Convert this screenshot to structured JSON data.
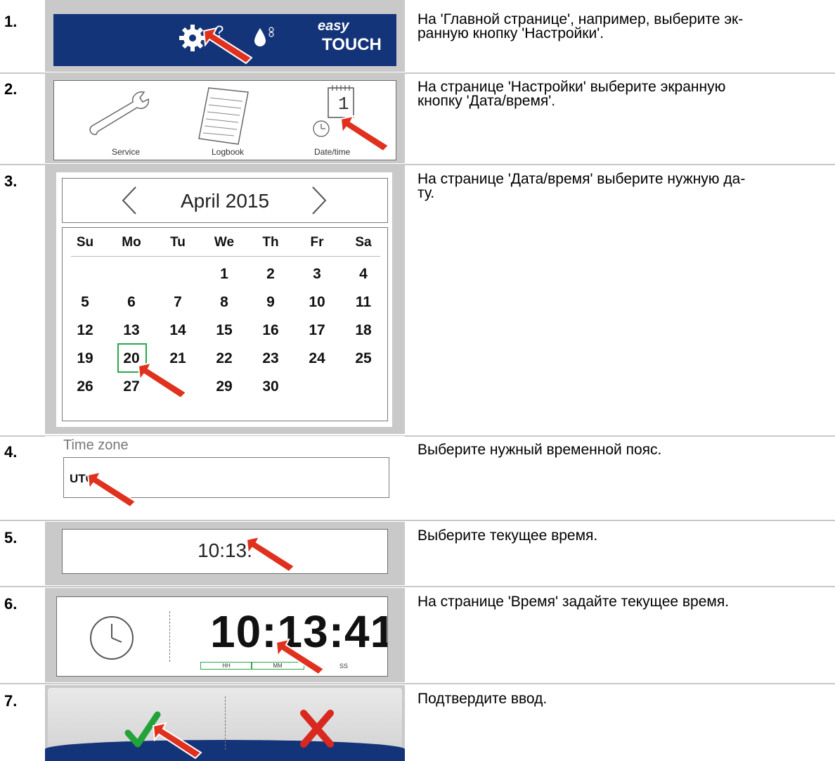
{
  "steps": [
    {
      "number": "1.",
      "text": "На 'Главной странице', например, выберите эк-\nранную кнопку 'Настройки'."
    },
    {
      "number": "2.",
      "text": "На странице 'Настройки' выберите экранную\nкнопку 'Дата/время'."
    },
    {
      "number": "3.",
      "text": "На странице 'Дата/время' выберите нужную да-\nту."
    },
    {
      "number": "4.",
      "text": "Выберите нужный временной пояс."
    },
    {
      "number": "5.",
      "text": "Выберите текущее время."
    },
    {
      "number": "6.",
      "text": "На странице 'Время' задайте текущее время."
    },
    {
      "number": "7.",
      "text": "Подтвердите ввод."
    }
  ],
  "home": {
    "logo_top": "easy",
    "logo_bottom": "TOUCH"
  },
  "settings": {
    "service_label": "Service",
    "logbook_label": "Logbook",
    "datetime_label": "Date/time",
    "calendar_digit": "1"
  },
  "calendar": {
    "month_label": "April 2015",
    "weekdays": [
      "Su",
      "Mo",
      "Tu",
      "We",
      "Th",
      "Fr",
      "Sa"
    ],
    "weeks": [
      [
        "",
        "",
        "",
        "1",
        "2",
        "3",
        "4"
      ],
      [
        "5",
        "6",
        "7",
        "8",
        "9",
        "10",
        "11"
      ],
      [
        "12",
        "13",
        "14",
        "15",
        "16",
        "17",
        "18"
      ],
      [
        "19",
        "20",
        "21",
        "22",
        "23",
        "24",
        "25"
      ],
      [
        "26",
        "27",
        "",
        "29",
        "30",
        "",
        ""
      ]
    ],
    "selected_day": "20"
  },
  "timezone": {
    "label": "Time zone",
    "value": "UTC"
  },
  "time_field": {
    "value": "10:13:"
  },
  "time_page": {
    "time": "10:13:41",
    "hh": "HH",
    "mm": "MM",
    "ss": "SS"
  },
  "colors": {
    "accent_green": "#2aa84a",
    "arrow_red": "#e0301e",
    "brand_blue": "#14347a"
  }
}
